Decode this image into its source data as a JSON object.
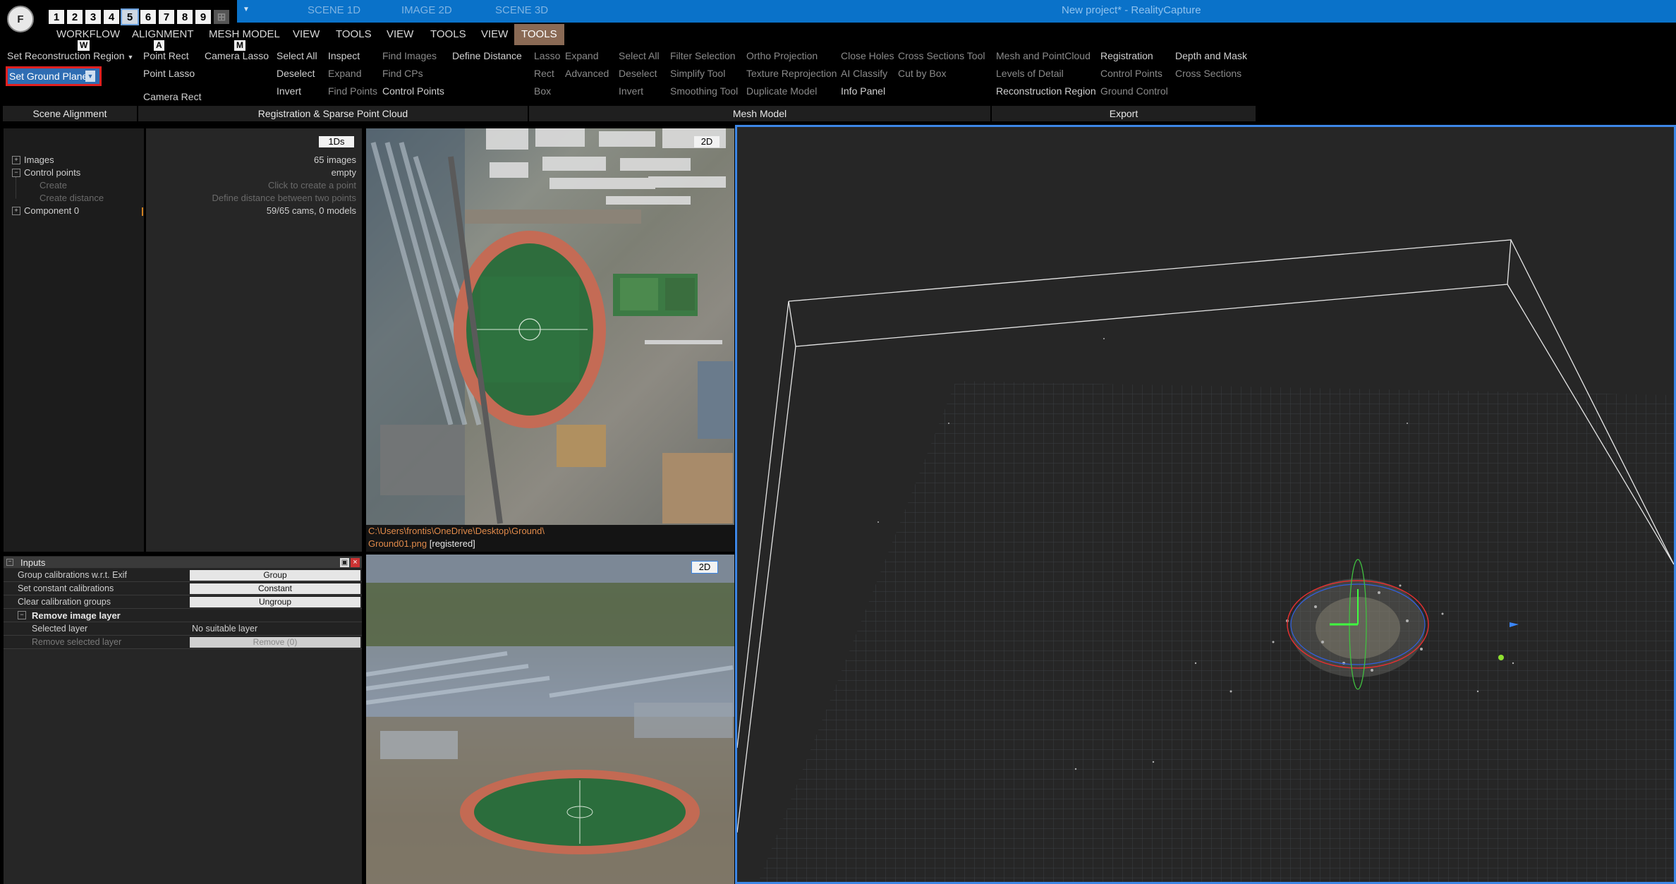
{
  "titlebar": {
    "logo_letter": "F",
    "layouts": [
      "1",
      "2",
      "3",
      "4",
      "5",
      "6",
      "7",
      "8",
      "9"
    ],
    "scene_tabs": [
      "SCENE 1D",
      "IMAGE 2D",
      "SCENE 3D"
    ],
    "window_title": "New project* - RealityCapture"
  },
  "menu": {
    "tabs": [
      "WORKFLOW",
      "ALIGNMENT",
      "MESH MODEL",
      "VIEW",
      "TOOLS",
      "VIEW",
      "TOOLS",
      "VIEW",
      "TOOLS"
    ],
    "key_hints": [
      "W",
      "A",
      "M"
    ]
  },
  "ribbon": {
    "set_reconstruction_region": "Set Reconstruction Region",
    "set_ground_plane": "Set Ground Plane",
    "point_rect": "Point Rect",
    "point_lasso": "Point Lasso",
    "camera_lasso": "Camera Lasso",
    "camera_rect": "Camera Rect",
    "select_all": "Select All",
    "deselect": "Deselect",
    "invert": "Invert",
    "inspect": "Inspect",
    "expand": "Expand",
    "find_points": "Find Points",
    "find_images": "Find Images",
    "find_cps": "Find CPs",
    "control_points": "Control Points",
    "define_distance": "Define Distance",
    "lasso": "Lasso",
    "rect": "Rect",
    "box": "Box",
    "expand2": "Expand",
    "advanced": "Advanced",
    "select_all2": "Select All",
    "deselect2": "Deselect",
    "invert2": "Invert",
    "filter_selection": "Filter Selection",
    "simplify_tool": "Simplify Tool",
    "smoothing_tool": "Smoothing Tool",
    "ortho_projection": "Ortho Projection",
    "texture_reprojection": "Texture Reprojection",
    "duplicate_model": "Duplicate Model",
    "close_holes": "Close Holes",
    "ai_classify": "AI Classify",
    "info_panel": "Info Panel",
    "cross_sections_tool": "Cross Sections Tool",
    "cut_by_box": "Cut by Box",
    "mesh_and_pointcloud": "Mesh and PointCloud",
    "levels_of_detail": "Levels of Detail",
    "reconstruction_region": "Reconstruction Region",
    "registration": "Registration",
    "control_points2": "Control Points",
    "ground_control": "Ground Control",
    "depth_and_mask": "Depth and Mask",
    "cross_sections": "Cross Sections",
    "groups": [
      "Scene Alignment",
      "Registration & Sparse Point Cloud",
      "Mesh Model",
      "Export"
    ]
  },
  "tree": {
    "images": "Images",
    "control_points": "Control points",
    "create": "Create",
    "create_distance": "Create distance",
    "component": "Component 0",
    "values": {
      "images": "65 images",
      "control_points": "empty",
      "create": "Click to create a point",
      "create_distance": "Define distance between two points",
      "component": "59/65 cams, 0 models"
    },
    "badge": "1Ds"
  },
  "inputs": {
    "title": "Inputs",
    "rows": [
      {
        "label": "Group calibrations w.r.t. Exif",
        "value": "Group"
      },
      {
        "label": "Set constant calibrations",
        "value": "Constant"
      },
      {
        "label": "Clear calibration groups",
        "value": "Ungroup"
      }
    ],
    "section": "Remove image layer",
    "selected_layer_label": "Selected layer",
    "selected_layer_value": "No suitable layer",
    "remove_label": "Remove selected layer",
    "remove_value": "Remove (0)"
  },
  "image_view": {
    "badge_top": "2D",
    "badge_bottom": "2D",
    "path": "C:\\Users\\frontis\\OneDrive\\Desktop\\Ground\\",
    "filename": "Ground01.png",
    "status": "[registered]"
  },
  "colors": {
    "accent_blue": "#0a72c9",
    "highlight_red": "#e02020",
    "active_tab": "#8a6a55",
    "view_border": "#3d87e6"
  }
}
